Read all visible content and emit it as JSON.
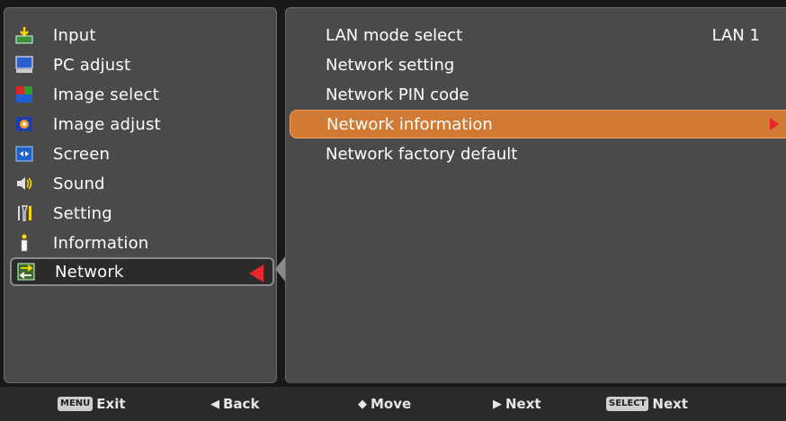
{
  "main_menu": {
    "items": [
      {
        "label": "Input",
        "icon": "input-icon"
      },
      {
        "label": "PC adjust",
        "icon": "pc-adjust-icon"
      },
      {
        "label": "Image select",
        "icon": "image-select-icon"
      },
      {
        "label": "Image adjust",
        "icon": "image-adjust-icon"
      },
      {
        "label": "Screen",
        "icon": "screen-icon"
      },
      {
        "label": "Sound",
        "icon": "sound-icon"
      },
      {
        "label": "Setting",
        "icon": "setting-icon"
      },
      {
        "label": "Information",
        "icon": "information-icon"
      },
      {
        "label": "Network",
        "icon": "network-icon"
      }
    ],
    "selected": "Network"
  },
  "submenu": {
    "items": [
      {
        "label": "LAN mode select",
        "value": "LAN 1"
      },
      {
        "label": "Network setting",
        "value": ""
      },
      {
        "label": "Network PIN code",
        "value": ""
      },
      {
        "label": "Network information",
        "value": ""
      },
      {
        "label": "Network factory default",
        "value": ""
      }
    ],
    "highlighted": "Network information"
  },
  "help_bar": {
    "exit": {
      "key": "MENU",
      "label": "Exit"
    },
    "back": {
      "glyph": "◀",
      "label": "Back"
    },
    "move": {
      "glyph": "◆",
      "label": "Move"
    },
    "next": {
      "glyph": "▶",
      "label": "Next"
    },
    "select_next": {
      "key": "SELECT",
      "label": "Next"
    }
  },
  "colors": {
    "panel": "#4a4a4a",
    "highlight": "#d07a34",
    "arrow": "#e8242c"
  }
}
